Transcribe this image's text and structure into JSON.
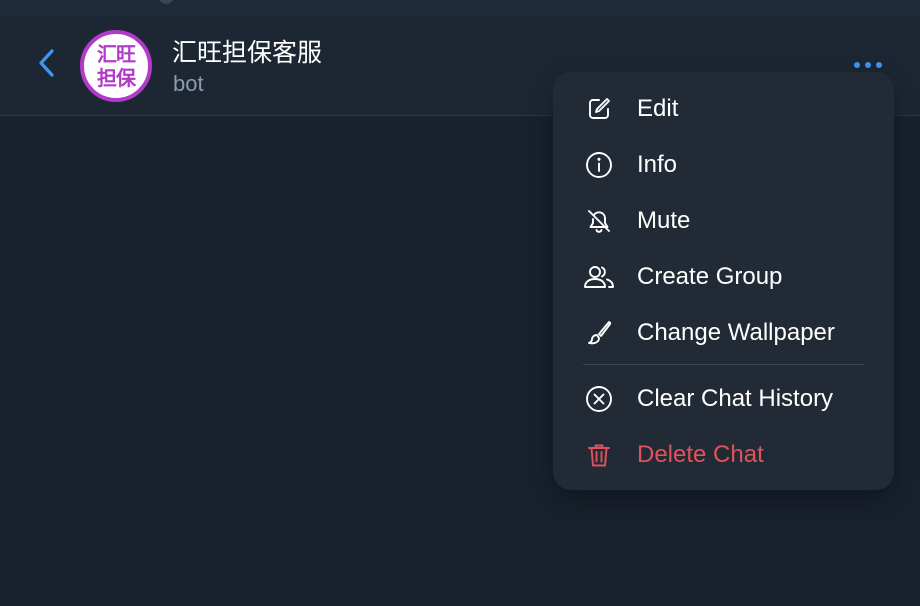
{
  "header": {
    "back_icon": "chevron-left-icon",
    "avatar_line1": "汇旺",
    "avatar_line2": "担保",
    "title": "汇旺担保客服",
    "subtitle": "bot",
    "more_icon": "more-horizontal-icon"
  },
  "menu": {
    "items": [
      {
        "label": "Edit",
        "icon": "edit-icon"
      },
      {
        "label": "Info",
        "icon": "info-icon"
      },
      {
        "label": "Mute",
        "icon": "bell-off-icon"
      },
      {
        "label": "Create Group",
        "icon": "users-icon"
      },
      {
        "label": "Change Wallpaper",
        "icon": "brush-icon"
      },
      {
        "label": "Clear Chat History",
        "icon": "clear-circle-icon"
      },
      {
        "label": "Delete Chat",
        "icon": "trash-icon"
      }
    ]
  },
  "colors": {
    "background": "#18212d",
    "header": "#1d2734",
    "menu": "#222a36",
    "accent": "#3e97f0",
    "avatar_border": "#b13ac9",
    "danger": "#e0535a"
  }
}
